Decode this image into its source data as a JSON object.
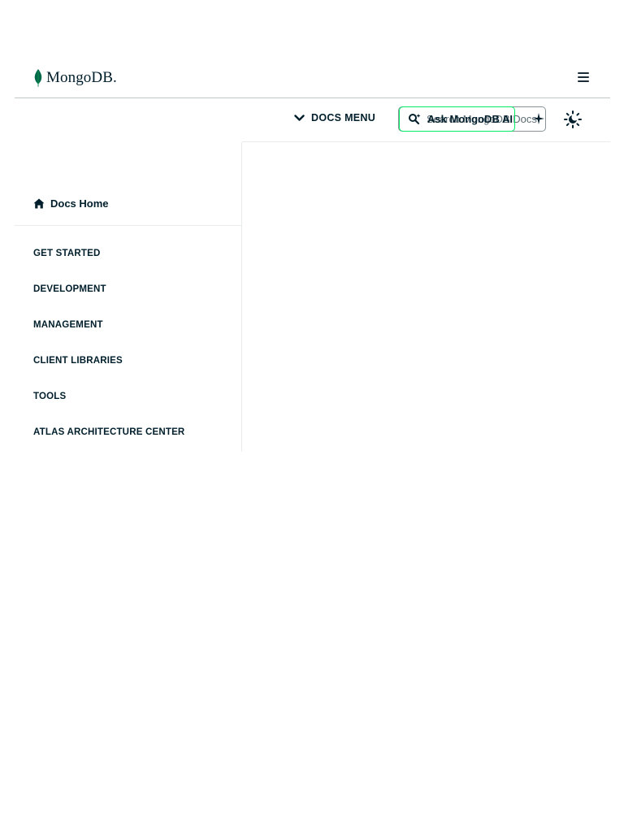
{
  "header": {
    "logo_text": "MongoDB.",
    "menu_icon": "hamburger-menu-icon"
  },
  "subbar": {
    "docs_menu_label": "DOCS MENU",
    "search_placeholder": "Search MongoDB Docs",
    "ask_ai_label": "Ask MongoDB AI",
    "icons": [
      "chevron-down-icon",
      "ai-search-icon",
      "sparkle-icon",
      "theme-toggle-icon"
    ]
  },
  "sidebar": {
    "home_label": "Docs Home",
    "items": [
      {
        "label": "GET STARTED"
      },
      {
        "label": "DEVELOPMENT"
      },
      {
        "label": "MANAGEMENT"
      },
      {
        "label": "CLIENT LIBRARIES"
      },
      {
        "label": "TOOLS"
      },
      {
        "label": "ATLAS ARCHITECTURE CENTER"
      }
    ]
  },
  "colors": {
    "brand_green": "#00ed64",
    "leaf_green": "#00684a",
    "text_dark": "#001e2b"
  }
}
